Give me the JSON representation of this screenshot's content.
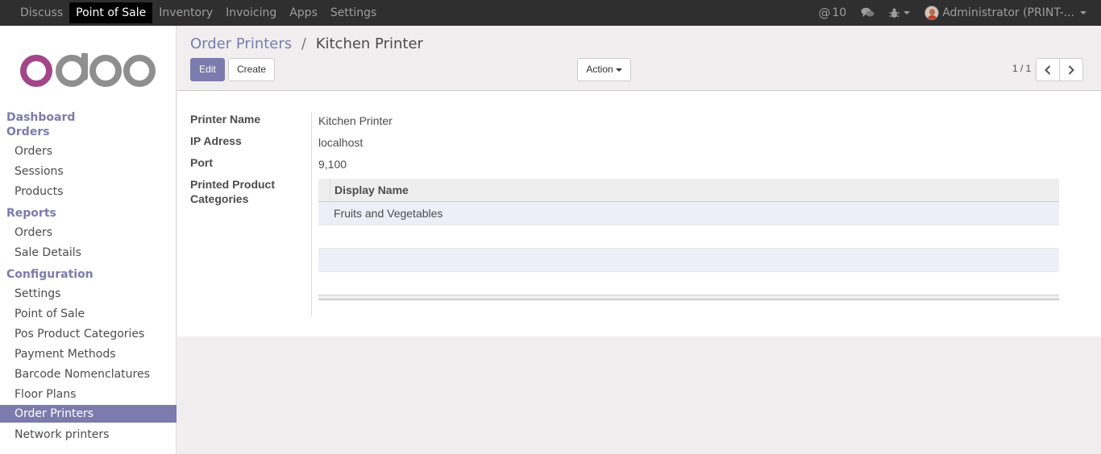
{
  "topbar": {
    "apps": [
      "Discuss",
      "Point of Sale",
      "Inventory",
      "Invoicing",
      "Apps",
      "Settings"
    ],
    "active_app": "Point of Sale",
    "mentions_count": "10",
    "user": "Administrator (PRINT-..."
  },
  "sidebar": {
    "logo_text": "odoo",
    "menu": [
      {
        "type": "section",
        "label": "Dashboard"
      },
      {
        "type": "section",
        "label": "Orders"
      },
      {
        "type": "item",
        "label": "Orders"
      },
      {
        "type": "item",
        "label": "Sessions"
      },
      {
        "type": "item",
        "label": "Products"
      },
      {
        "type": "section",
        "label": "Reports"
      },
      {
        "type": "item",
        "label": "Orders"
      },
      {
        "type": "item",
        "label": "Sale Details"
      },
      {
        "type": "section",
        "label": "Configuration"
      },
      {
        "type": "item",
        "label": "Settings"
      },
      {
        "type": "item",
        "label": "Point of Sale"
      },
      {
        "type": "item",
        "label": "Pos Product Categories"
      },
      {
        "type": "item",
        "label": "Payment Methods"
      },
      {
        "type": "item",
        "label": "Barcode Nomenclatures"
      },
      {
        "type": "item",
        "label": "Floor Plans"
      },
      {
        "type": "item",
        "label": "Order Printers",
        "active": true
      },
      {
        "type": "item",
        "label": "Network printers"
      }
    ]
  },
  "control": {
    "breadcrumb_parent": "Order Printers",
    "breadcrumb_sep": "/",
    "breadcrumb_current": "Kitchen Printer",
    "edit_label": "Edit",
    "create_label": "Create",
    "action_label": "Action",
    "pager": "1 / 1"
  },
  "form": {
    "printer_name_label": "Printer Name",
    "printer_name": "Kitchen Printer",
    "ip_label": "IP Adress",
    "ip": "localhost",
    "port_label": "Port",
    "port": "9,100",
    "categories_label_1": "Printed Product",
    "categories_label_2": "Categories",
    "grid_header": "Display Name",
    "grid_rows": [
      "Fruits and Vegetables"
    ]
  },
  "colors": {
    "accent": "#7c7bad",
    "navbar": "#2f2f2f",
    "logo_purple": "#a24689",
    "logo_gray": "#8f8f8f"
  }
}
